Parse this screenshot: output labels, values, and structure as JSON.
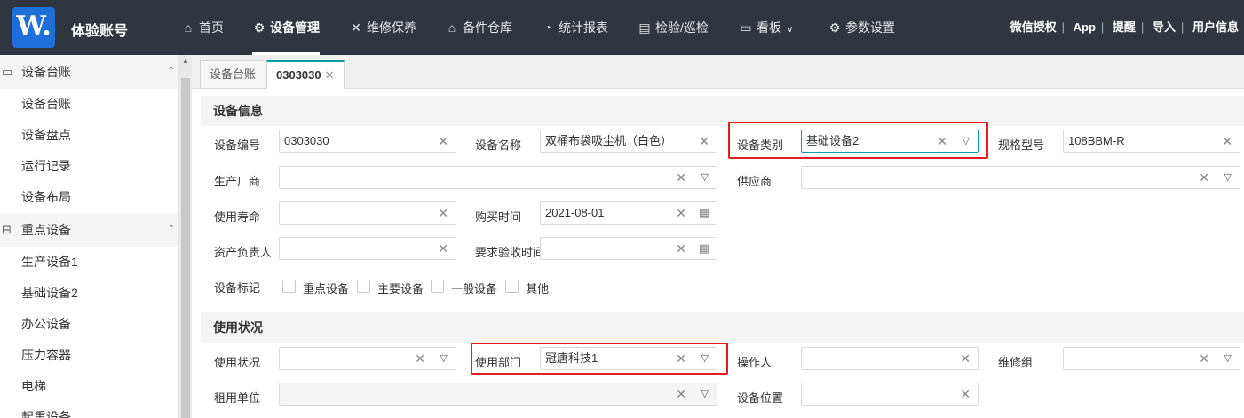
{
  "brand": {
    "logo_text": "W.",
    "app_name": "体验账号"
  },
  "nav": [
    {
      "label": "首页",
      "icon": "home-icon"
    },
    {
      "label": "设备管理",
      "icon": "equipment-icon"
    },
    {
      "label": "维修保养",
      "icon": "tools-icon"
    },
    {
      "label": "备件仓库",
      "icon": "warehouse-icon"
    },
    {
      "label": "统计报表",
      "icon": "pie-chart-icon"
    },
    {
      "label": "检验/巡检",
      "icon": "inspection-icon"
    },
    {
      "label": "看板",
      "icon": "monitor-icon"
    },
    {
      "label": "参数设置",
      "icon": "gear-icon"
    }
  ],
  "active_nav": "设备管理",
  "right_links": [
    "微信授权",
    "App",
    "提醒",
    "导入",
    "用户信息"
  ],
  "sidebar": {
    "groups": [
      {
        "label": "设备台账",
        "items": [
          "设备台账",
          "设备盘点",
          "运行记录",
          "设备布局"
        ]
      },
      {
        "label": "重点设备",
        "items": [
          "生产设备1",
          "基础设备2",
          "办公设备",
          "压力容器",
          "电梯",
          "起重设备"
        ]
      }
    ]
  },
  "tabs": [
    {
      "label": "设备台账"
    },
    {
      "label": "0303030",
      "closable": true
    }
  ],
  "sections": {
    "info": "设备信息",
    "usage": "使用状况"
  },
  "fields": {
    "code": {
      "label": "设备编号",
      "value": "0303030"
    },
    "name": {
      "label": "设备名称",
      "value": "双桶布袋吸尘机（白色）"
    },
    "category": {
      "label": "设备类别",
      "value": "基础设备2"
    },
    "model": {
      "label": "规格型号",
      "value": "108BBM-R"
    },
    "manufacturer": {
      "label": "生产厂商",
      "value": ""
    },
    "supplier": {
      "label": "供应商",
      "value": ""
    },
    "lifespan": {
      "label": "使用寿命",
      "value": ""
    },
    "purchase_date": {
      "label": "购买时间",
      "value": "2021-08-01"
    },
    "owner": {
      "label": "资产负责人",
      "value": ""
    },
    "acceptance_date": {
      "label": "要求验收时间",
      "value": ""
    },
    "usage_status": {
      "label": "使用状况",
      "value": ""
    },
    "department": {
      "label": "使用部门",
      "value": "冠唐科技1"
    },
    "operator": {
      "label": "操作人",
      "value": ""
    },
    "repair_group": {
      "label": "维修组",
      "value": ""
    },
    "lessee": {
      "label": "租用单位",
      "value": ""
    },
    "location": {
      "label": "设备位置",
      "value": ""
    }
  },
  "tags": {
    "label": "设备标记",
    "options": [
      "重点设备",
      "主要设备",
      "一般设备",
      "其他"
    ]
  },
  "colors": {
    "topbar": "#30363f",
    "tab_accent": "#0aa1a4",
    "highlight": "#e02020",
    "logo": "#1e6fd9"
  }
}
